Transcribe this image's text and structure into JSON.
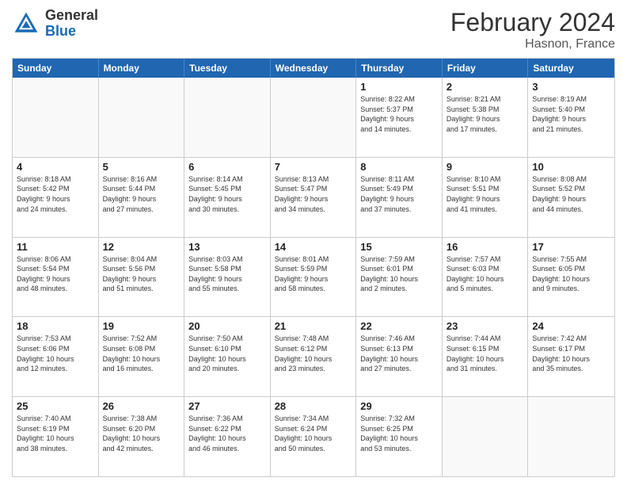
{
  "header": {
    "logo_general": "General",
    "logo_blue": "Blue",
    "month_title": "February 2024",
    "location": "Hasnon, France"
  },
  "weekdays": [
    "Sunday",
    "Monday",
    "Tuesday",
    "Wednesday",
    "Thursday",
    "Friday",
    "Saturday"
  ],
  "rows": [
    [
      {
        "day": "",
        "info": ""
      },
      {
        "day": "",
        "info": ""
      },
      {
        "day": "",
        "info": ""
      },
      {
        "day": "",
        "info": ""
      },
      {
        "day": "1",
        "info": "Sunrise: 8:22 AM\nSunset: 5:37 PM\nDaylight: 9 hours\nand 14 minutes."
      },
      {
        "day": "2",
        "info": "Sunrise: 8:21 AM\nSunset: 5:38 PM\nDaylight: 9 hours\nand 17 minutes."
      },
      {
        "day": "3",
        "info": "Sunrise: 8:19 AM\nSunset: 5:40 PM\nDaylight: 9 hours\nand 21 minutes."
      }
    ],
    [
      {
        "day": "4",
        "info": "Sunrise: 8:18 AM\nSunset: 5:42 PM\nDaylight: 9 hours\nand 24 minutes."
      },
      {
        "day": "5",
        "info": "Sunrise: 8:16 AM\nSunset: 5:44 PM\nDaylight: 9 hours\nand 27 minutes."
      },
      {
        "day": "6",
        "info": "Sunrise: 8:14 AM\nSunset: 5:45 PM\nDaylight: 9 hours\nand 30 minutes."
      },
      {
        "day": "7",
        "info": "Sunrise: 8:13 AM\nSunset: 5:47 PM\nDaylight: 9 hours\nand 34 minutes."
      },
      {
        "day": "8",
        "info": "Sunrise: 8:11 AM\nSunset: 5:49 PM\nDaylight: 9 hours\nand 37 minutes."
      },
      {
        "day": "9",
        "info": "Sunrise: 8:10 AM\nSunset: 5:51 PM\nDaylight: 9 hours\nand 41 minutes."
      },
      {
        "day": "10",
        "info": "Sunrise: 8:08 AM\nSunset: 5:52 PM\nDaylight: 9 hours\nand 44 minutes."
      }
    ],
    [
      {
        "day": "11",
        "info": "Sunrise: 8:06 AM\nSunset: 5:54 PM\nDaylight: 9 hours\nand 48 minutes."
      },
      {
        "day": "12",
        "info": "Sunrise: 8:04 AM\nSunset: 5:56 PM\nDaylight: 9 hours\nand 51 minutes."
      },
      {
        "day": "13",
        "info": "Sunrise: 8:03 AM\nSunset: 5:58 PM\nDaylight: 9 hours\nand 55 minutes."
      },
      {
        "day": "14",
        "info": "Sunrise: 8:01 AM\nSunset: 5:59 PM\nDaylight: 9 hours\nand 58 minutes."
      },
      {
        "day": "15",
        "info": "Sunrise: 7:59 AM\nSunset: 6:01 PM\nDaylight: 10 hours\nand 2 minutes."
      },
      {
        "day": "16",
        "info": "Sunrise: 7:57 AM\nSunset: 6:03 PM\nDaylight: 10 hours\nand 5 minutes."
      },
      {
        "day": "17",
        "info": "Sunrise: 7:55 AM\nSunset: 6:05 PM\nDaylight: 10 hours\nand 9 minutes."
      }
    ],
    [
      {
        "day": "18",
        "info": "Sunrise: 7:53 AM\nSunset: 6:06 PM\nDaylight: 10 hours\nand 12 minutes."
      },
      {
        "day": "19",
        "info": "Sunrise: 7:52 AM\nSunset: 6:08 PM\nDaylight: 10 hours\nand 16 minutes."
      },
      {
        "day": "20",
        "info": "Sunrise: 7:50 AM\nSunset: 6:10 PM\nDaylight: 10 hours\nand 20 minutes."
      },
      {
        "day": "21",
        "info": "Sunrise: 7:48 AM\nSunset: 6:12 PM\nDaylight: 10 hours\nand 23 minutes."
      },
      {
        "day": "22",
        "info": "Sunrise: 7:46 AM\nSunset: 6:13 PM\nDaylight: 10 hours\nand 27 minutes."
      },
      {
        "day": "23",
        "info": "Sunrise: 7:44 AM\nSunset: 6:15 PM\nDaylight: 10 hours\nand 31 minutes."
      },
      {
        "day": "24",
        "info": "Sunrise: 7:42 AM\nSunset: 6:17 PM\nDaylight: 10 hours\nand 35 minutes."
      }
    ],
    [
      {
        "day": "25",
        "info": "Sunrise: 7:40 AM\nSunset: 6:19 PM\nDaylight: 10 hours\nand 38 minutes."
      },
      {
        "day": "26",
        "info": "Sunrise: 7:38 AM\nSunset: 6:20 PM\nDaylight: 10 hours\nand 42 minutes."
      },
      {
        "day": "27",
        "info": "Sunrise: 7:36 AM\nSunset: 6:22 PM\nDaylight: 10 hours\nand 46 minutes."
      },
      {
        "day": "28",
        "info": "Sunrise: 7:34 AM\nSunset: 6:24 PM\nDaylight: 10 hours\nand 50 minutes."
      },
      {
        "day": "29",
        "info": "Sunrise: 7:32 AM\nSunset: 6:25 PM\nDaylight: 10 hours\nand 53 minutes."
      },
      {
        "day": "",
        "info": ""
      },
      {
        "day": "",
        "info": ""
      }
    ]
  ]
}
